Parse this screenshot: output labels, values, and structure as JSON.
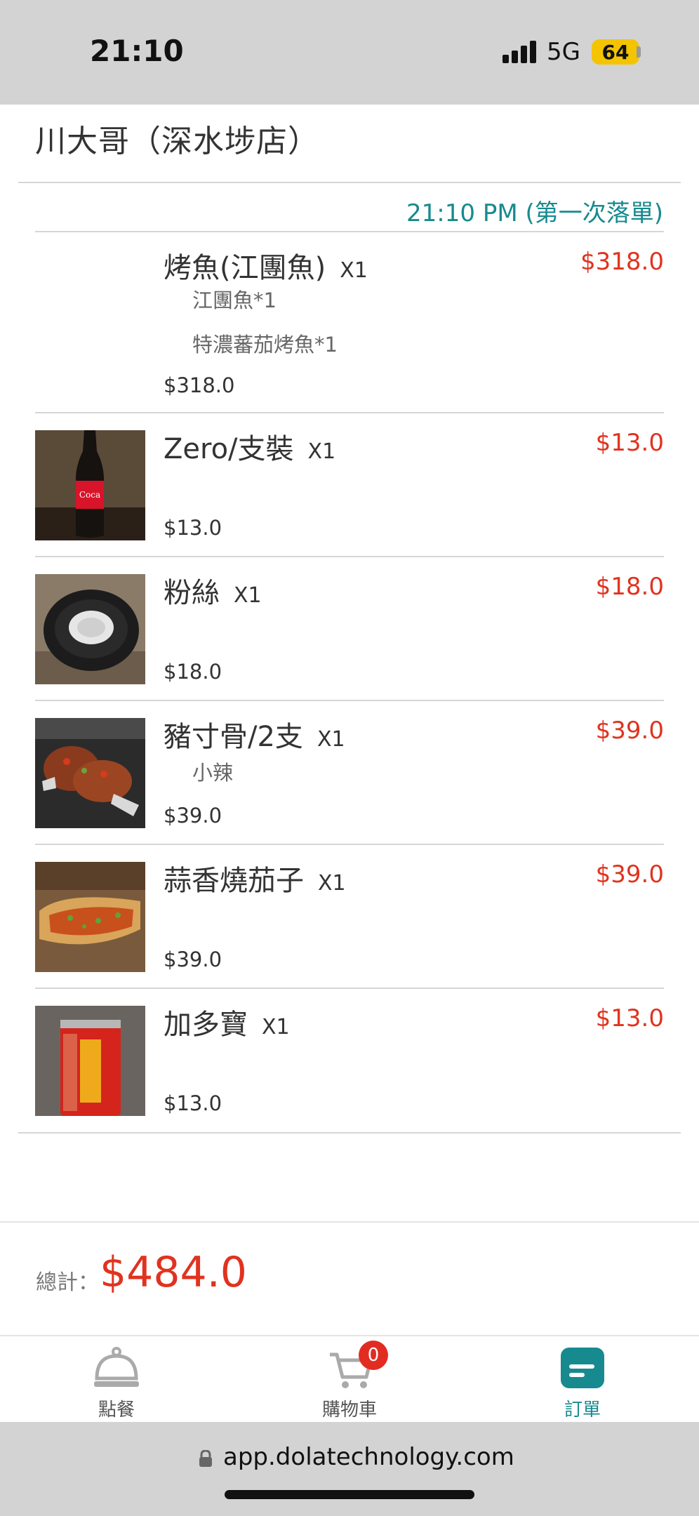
{
  "status_bar": {
    "time": "21:10",
    "network": "5G",
    "battery": "64"
  },
  "store": {
    "name": "川大哥（深水埗店）"
  },
  "order": {
    "time_label": "21:10 PM (第一次落單)"
  },
  "items": [
    {
      "name": "烤魚(江團魚)",
      "qty": "X1",
      "total": "$318.0",
      "options": [
        "江團魚*1",
        "特濃蕃茄烤魚*1"
      ],
      "price": "$318.0",
      "image": "none"
    },
    {
      "name": "Zero/支裝",
      "qty": "X1",
      "total": "$13.0",
      "options": [],
      "price": "$13.0",
      "image": "coke-zero-bottle"
    },
    {
      "name": "粉絲",
      "qty": "X1",
      "total": "$18.0",
      "options": [],
      "price": "$18.0",
      "image": "vermicelli-bowl"
    },
    {
      "name": "豬寸骨/2支",
      "qty": "X1",
      "total": "$39.0",
      "options": [
        "小辣"
      ],
      "price": "$39.0",
      "image": "pork-ribs"
    },
    {
      "name": "蒜香燒茄子",
      "qty": "X1",
      "total": "$39.0",
      "options": [],
      "price": "$39.0",
      "image": "grilled-eggplant"
    },
    {
      "name": "加多寶",
      "qty": "X1",
      "total": "$13.0",
      "options": [],
      "price": "$13.0",
      "image": "herbal-tea-can"
    }
  ],
  "summary": {
    "total_label": "總計：",
    "total_value": "$484.0"
  },
  "tabs": [
    {
      "label": "點餐",
      "icon": "cloche-icon",
      "active": false
    },
    {
      "label": "購物車",
      "icon": "cart-icon",
      "active": false,
      "badge": "0"
    },
    {
      "label": "訂單",
      "icon": "orders-icon",
      "active": true
    }
  ],
  "browser": {
    "url": "app.dolatechnology.com"
  },
  "colors": {
    "accent": "#178a8f",
    "price": "#e0331f",
    "badge": "#e22c22"
  }
}
